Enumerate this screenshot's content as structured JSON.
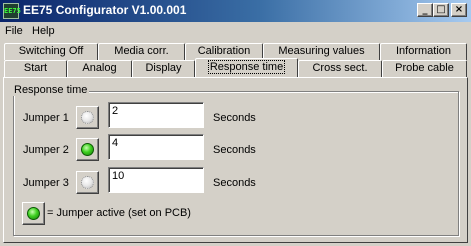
{
  "window": {
    "title": "EE75 Configurator V1.00.001",
    "icon_text": "EE75",
    "icon": "app-icon",
    "minimize_icon": "minimize-icon",
    "maximize_icon": "maximize-icon",
    "close_icon": "close-icon"
  },
  "menu": {
    "file": "File",
    "help": "Help"
  },
  "tabs": {
    "row1": [
      "Switching Off",
      "Media corr.",
      "Calibration",
      "Measuring values",
      "Information"
    ],
    "row2": [
      "Start",
      "Analog",
      "Display",
      "Response time",
      "Cross sect.",
      "Probe cable"
    ],
    "active": "Response time"
  },
  "group": {
    "title": "Response time",
    "jumpers": [
      {
        "label": "Jumper 1",
        "value": "2",
        "unit": "Seconds",
        "active": false
      },
      {
        "label": "Jumper 2",
        "value": "4",
        "unit": "Seconds",
        "active": true
      },
      {
        "label": "Jumper 3",
        "value": "10",
        "unit": "Seconds",
        "active": false
      }
    ],
    "legend": "= Jumper active (set on PCB)"
  },
  "colors": {
    "led_on": "#3ed020",
    "led_off": "#e8e8e8",
    "title_bar": "#0a246a"
  }
}
